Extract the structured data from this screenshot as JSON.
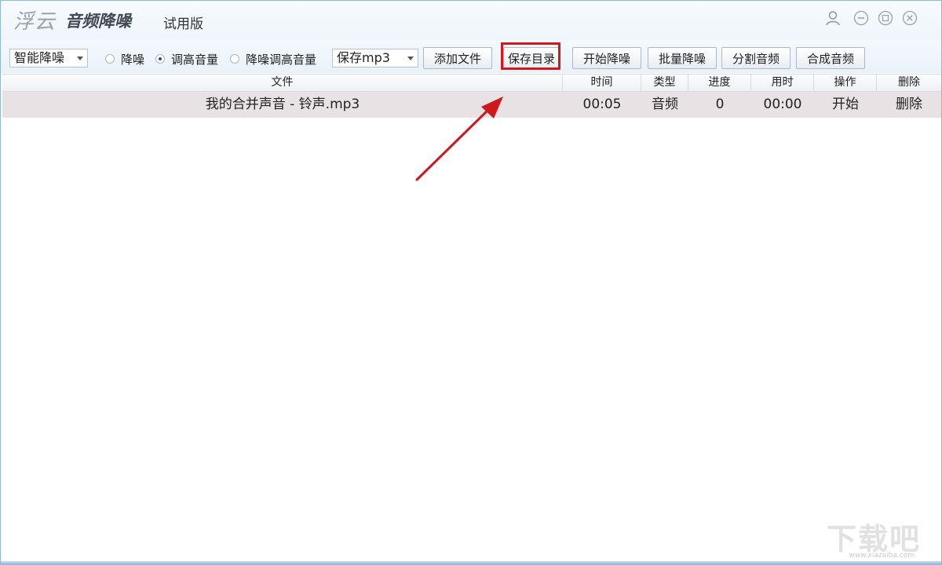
{
  "app": {
    "brand_prefix": "浮云",
    "brand_name": "音频降噪",
    "edition": "试用版"
  },
  "window_controls": [
    "user-icon",
    "minimize-icon",
    "maximize-icon",
    "close-icon"
  ],
  "toolbar": {
    "mode_select": {
      "value": "智能降噪"
    },
    "radios": [
      {
        "label": "降噪",
        "checked": false
      },
      {
        "label": "调高音量",
        "checked": true
      },
      {
        "label": "降噪调高音量",
        "checked": false
      }
    ],
    "format_select": {
      "value": "保存mp3"
    },
    "buttons": {
      "add_file": "添加文件",
      "save_dir": "保存目录",
      "start_denoise": "开始降噪",
      "batch_denoise": "批量降噪",
      "split_audio": "分割音频",
      "merge_audio": "合成音频"
    }
  },
  "table": {
    "headers": [
      "文件",
      "时间",
      "类型",
      "进度",
      "用时",
      "操作",
      "删除"
    ],
    "rows": [
      {
        "file": "我的合并声音 - 铃声.mp3",
        "time": "00:05",
        "type": "音频",
        "progress": "0",
        "elapsed": "00:00",
        "action": "开始",
        "delete": "删除"
      }
    ]
  },
  "annotation": {
    "highlight_color": "#d0191d",
    "arrow_color": "#d0191d"
  },
  "watermark": {
    "main": "下载吧",
    "sub": "www.xiazaiba.com"
  }
}
